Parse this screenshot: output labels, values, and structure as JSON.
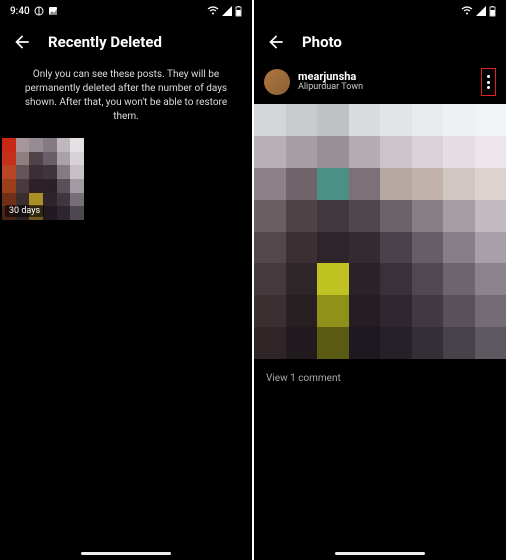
{
  "left": {
    "status": {
      "time": "9:40"
    },
    "header": {
      "title": "Recently Deleted"
    },
    "info": "Only you can see these posts. They will be permanently deleted after the number of days shown. After that, you won't be able to restore them.",
    "thumbnails": [
      {
        "badge": "30 days"
      }
    ]
  },
  "right": {
    "header": {
      "title": "Photo"
    },
    "post": {
      "username": "mearjunsha",
      "location": "Alipurduar Town",
      "comments_link": "View 1 comment"
    }
  }
}
